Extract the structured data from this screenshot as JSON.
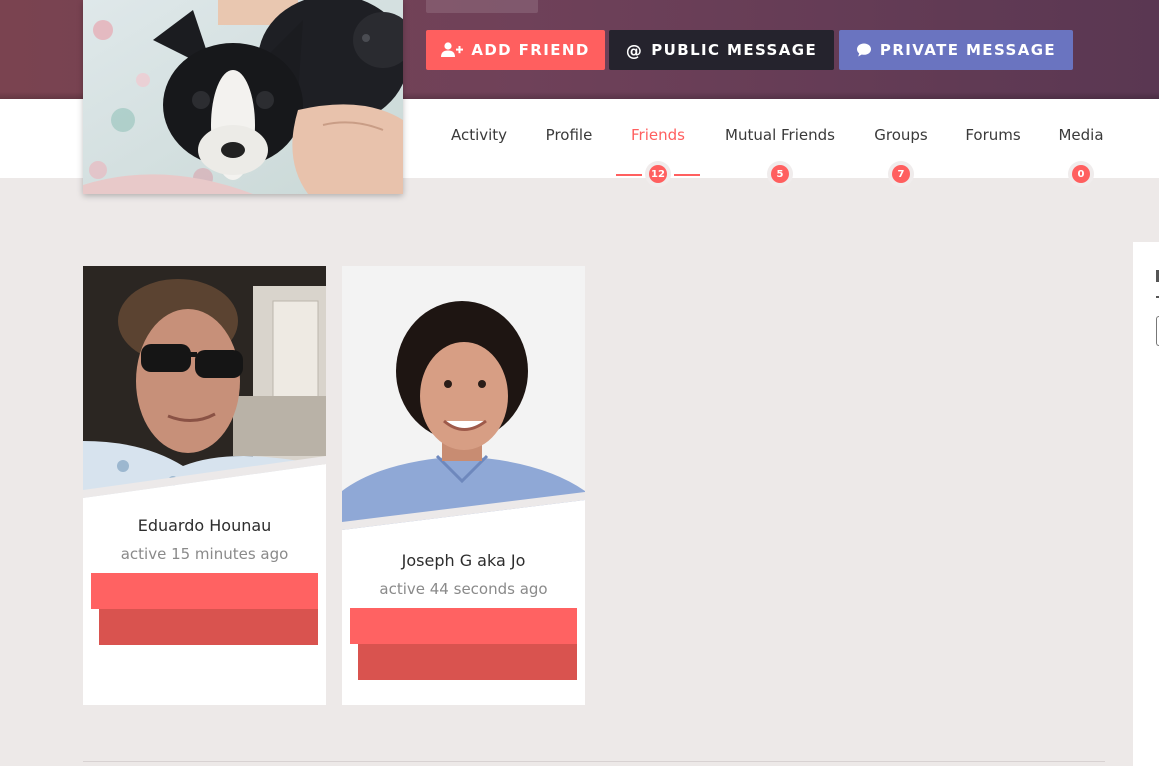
{
  "header": {
    "actions": {
      "add_friend": "ADD FRIEND",
      "public_message": "PUBLIC MESSAGE",
      "private_message": "PRIVATE MESSAGE"
    }
  },
  "tabs": [
    {
      "label": "Activity",
      "count": null,
      "active": false
    },
    {
      "label": "Profile",
      "count": null,
      "active": false
    },
    {
      "label": "Friends",
      "count": "12",
      "active": true
    },
    {
      "label": "Mutual Friends",
      "count": "5",
      "active": false
    },
    {
      "label": "Groups",
      "count": "7",
      "active": false
    },
    {
      "label": "Forums",
      "count": null,
      "active": false
    },
    {
      "label": "Media",
      "count": "0",
      "active": false
    }
  ],
  "friends": [
    {
      "name": "Eduardo Hounau",
      "status": "active 15 minutes ago"
    },
    {
      "name": "Joseph G aka Jo",
      "status": "active 44 seconds ago"
    }
  ],
  "colors": {
    "accent": "#ff5f5f",
    "dark": "#25232d",
    "purple": "#6a74c0",
    "remove": "#d9534f"
  },
  "icons": {
    "add_friend": "user-plus-icon",
    "public_message": "at-sign-icon",
    "private_message": "chat-bubble-icon"
  }
}
